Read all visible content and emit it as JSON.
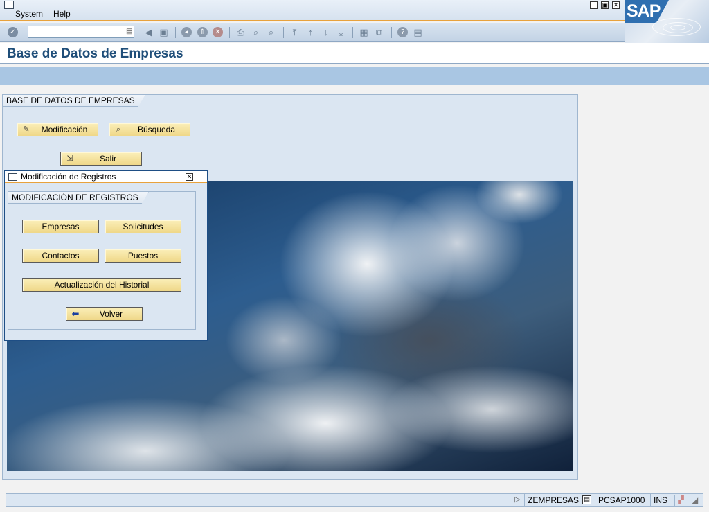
{
  "menu": {
    "items": [
      "System",
      "Help"
    ]
  },
  "window_controls": {
    "minimize": "_",
    "restore": "▣",
    "close": "✕"
  },
  "logo": {
    "text": "SAP"
  },
  "toolbar": {
    "command_value": "",
    "icons": [
      "enter-icon",
      "back-icon",
      "exit-icon",
      "cancel-icon",
      "print-icon",
      "find-icon",
      "find-next-icon",
      "first-page-icon",
      "previous-page-icon",
      "next-page-icon",
      "last-page-icon",
      "create-session-icon",
      "shortcut-icon",
      "help-icon",
      "layout-menu-icon"
    ]
  },
  "title": {
    "text": "Base de Datos de Empresas"
  },
  "main_group": {
    "label": "BASE DE DATOS DE EMPRESAS",
    "buttons": {
      "modificacion": "Modificación",
      "busqueda": "Búsqueda",
      "salir": "Salir"
    }
  },
  "popup": {
    "title": "Modificación de Registros",
    "group_label": "MODIFICACIÓN DE REGISTROS",
    "buttons": {
      "empresas": "Empresas",
      "solicitudes": "Solicitudes",
      "contactos": "Contactos",
      "puestos": "Puestos",
      "historial": "Actualización del Historial",
      "volver": "Volver"
    }
  },
  "status": {
    "program": "ZEMPRESAS",
    "server": "PCSAP1000",
    "mode": "INS"
  }
}
